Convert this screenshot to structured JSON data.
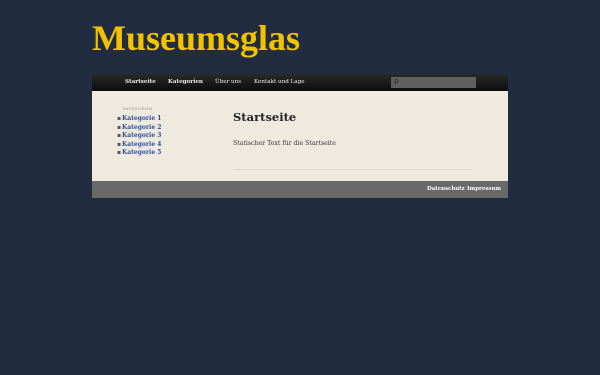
{
  "site": {
    "title": "Museumsglas"
  },
  "nav": {
    "items": [
      {
        "label": "Startseite",
        "bold": true
      },
      {
        "label": "Kategorien",
        "bold": true
      },
      {
        "label": "Über uns",
        "bold": false
      },
      {
        "label": "Kontakt und Lage",
        "bold": false
      }
    ],
    "search_placeholder": ""
  },
  "sidebar": {
    "heading": "KATEGORIEN",
    "items": [
      "Kategorie 1",
      "Kategorie 2",
      "Kategorie 3",
      "Kategorie 4",
      "Kategorie 5"
    ]
  },
  "main": {
    "title": "Startseite",
    "text": "Statischer Text für die Startseite"
  },
  "footer": {
    "links": [
      "Datenschutz",
      "Impressum"
    ]
  },
  "colors": {
    "background": "#212c41",
    "title": "#f2c200",
    "link": "#2b4f9e",
    "content_bg": "#eeeae0",
    "footer_bg": "#696969"
  }
}
